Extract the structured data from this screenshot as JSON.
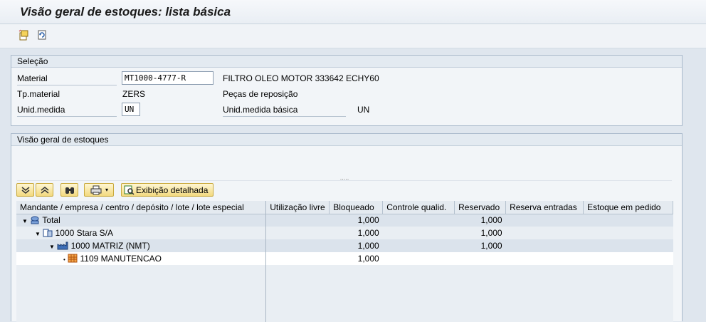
{
  "title": "Visão geral de estoques: lista básica",
  "toolbar": {
    "icons": [
      "new-document-icon",
      "refresh-icon"
    ]
  },
  "selection": {
    "header": "Seleção",
    "material_label": "Material",
    "material_value": "MT1000-4777-R",
    "material_desc": "FILTRO OLEO MOTOR 333642 ECHY60",
    "type_label": "Tp.material",
    "type_value": "ZERS",
    "type_desc": "Peças de reposição",
    "unit_label": "Unid.medida",
    "unit_value": "UN",
    "base_unit_label": "Unid.medida básica",
    "base_unit_value": "UN"
  },
  "overview": {
    "header": "Visão geral de estoques",
    "splitter": ".....",
    "detail_button": "Exibição detalhada",
    "columns": [
      "Mandante / empresa / centro / depósito / lote / lote especial",
      "Utilização livre",
      "Bloqueado",
      "Controle qualid.",
      "Reservado",
      "Reserva entradas",
      "Estoque em pedido"
    ],
    "rows": [
      {
        "label": "Total",
        "icon": "scale-icon",
        "expander": "▼",
        "cells": [
          "",
          "1,000",
          "",
          "1,000",
          "",
          ""
        ]
      },
      {
        "label": "1000 Stara S/A",
        "icon": "company-icon",
        "expander": "▼",
        "cells": [
          "",
          "1,000",
          "",
          "1,000",
          "",
          ""
        ]
      },
      {
        "label": "1000 MATRIZ (NMT)",
        "icon": "factory-icon",
        "expander": "▼",
        "cells": [
          "",
          "1,000",
          "",
          "1,000",
          "",
          ""
        ]
      },
      {
        "label": "1109 MANUTENCAO",
        "icon": "warehouse-icon",
        "expander": "•",
        "cells": [
          "",
          "1,000",
          "",
          "",
          "",
          ""
        ]
      }
    ]
  }
}
